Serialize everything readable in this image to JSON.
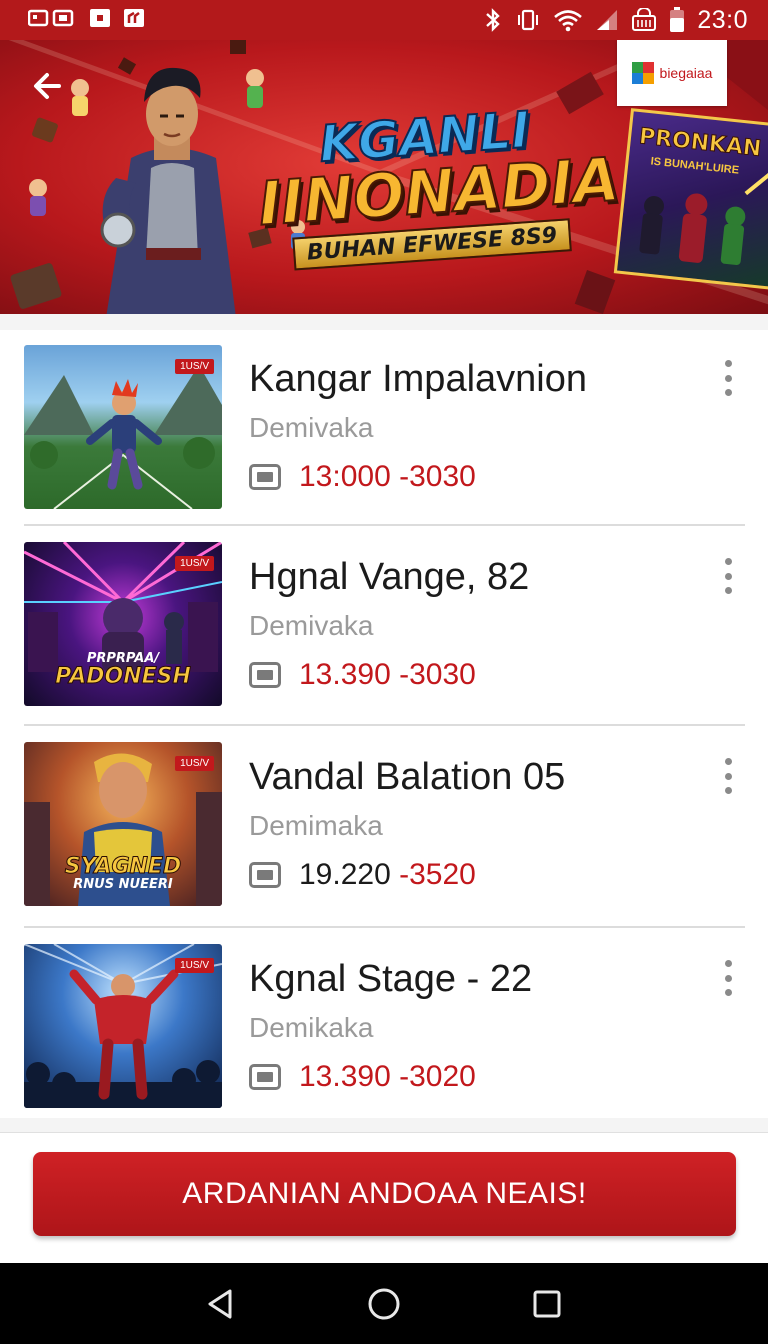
{
  "status_bar": {
    "time": "23:0",
    "icons": [
      "sim-icon",
      "notification-icon",
      "app-icon",
      "bluetooth-icon",
      "vibrate-icon",
      "wifi-icon",
      "signal-icon",
      "battery-icon"
    ]
  },
  "hero": {
    "title_line1": "KGANLI",
    "title_line2": "IINONADIA",
    "title_line3": "BUHAN EFWESE 8S9",
    "brand_label": "biegaiaa",
    "poster_title": "PRONKAN",
    "poster_sub": "IS BUNAH'LUIRE"
  },
  "items": [
    {
      "title": "Kangar Impalavnion",
      "subtitle": "Demivaka",
      "price_a": "13:000",
      "price_b": "-3030",
      "price_a_dark": false,
      "tag": "1US/V",
      "caption": "",
      "caption_sub": "",
      "colors": {
        "accent": "#2e8b3a"
      }
    },
    {
      "title": "Hgnal Vange, 82",
      "subtitle": "Demivaka",
      "price_a": "13.390",
      "price_b": "-3030",
      "price_a_dark": false,
      "tag": "1US/V",
      "caption": "PADONESH",
      "caption_sub": "PRPRPAA/",
      "colors": {
        "accent": "#6a2aa8"
      }
    },
    {
      "title": "Vandal Balation 05",
      "subtitle": "Demimaka",
      "price_a": "19.220",
      "price_b": "-3520",
      "price_a_dark": true,
      "tag": "1US/V",
      "caption": "SYAGNED",
      "caption_sub": "RNUS NUEERI",
      "colors": {
        "accent": "#c86a1c"
      }
    },
    {
      "title": "Kgnal Stage - 22",
      "subtitle": "Demikaka",
      "price_a": "13.390",
      "price_b": "-3020",
      "price_a_dark": false,
      "tag": "1US/V",
      "caption": "",
      "caption_sub": "",
      "colors": {
        "accent": "#2a5fb0"
      }
    }
  ],
  "cta": {
    "label": "ARDANIAN ANDOAA NEAIS!"
  },
  "navbar": {
    "buttons": [
      "back-nav-icon",
      "home-nav-icon",
      "recents-nav-icon"
    ]
  },
  "colors": {
    "primary_red": "#c2181c",
    "status_bar": "#b3191b"
  }
}
